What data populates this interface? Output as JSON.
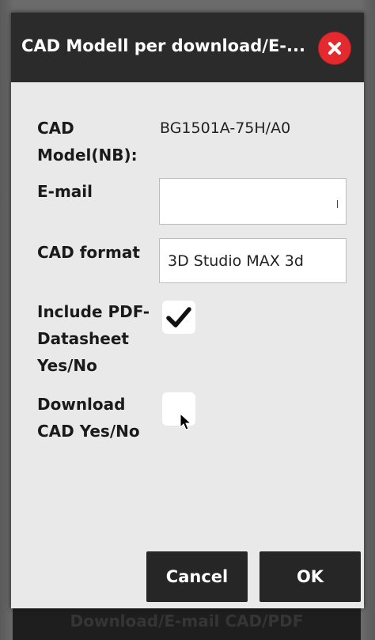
{
  "background": {
    "bar_label": "Download/E-mail CAD/PDF"
  },
  "dialog": {
    "title": "CAD Modell per download/E-...",
    "close_icon": "close-x-circle-icon",
    "fields": {
      "cad_model_label_line1": "CAD",
      "cad_model_label_line2": "Model(NB):",
      "cad_model_value": "BG1501A-75H/A0",
      "email_label": "E-mail",
      "email_value": "",
      "cad_format_label": "CAD format",
      "cad_format_value": "3D Studio MAX 3d",
      "include_pdf_label_line1": "Include PDF-",
      "include_pdf_label_line2": "Datasheet",
      "include_pdf_label_line3": "Yes/No",
      "include_pdf_checked": true,
      "download_cad_label_line1": "Download",
      "download_cad_label_line2": "CAD Yes/No",
      "download_cad_checked": false
    },
    "buttons": {
      "cancel_label": "Cancel",
      "ok_label": "OK"
    }
  },
  "colors": {
    "titlebar": "#2b2b2b",
    "dialog_body": "#e9e9e9",
    "close_button": "#e52a2f",
    "buttons": "#262626"
  }
}
